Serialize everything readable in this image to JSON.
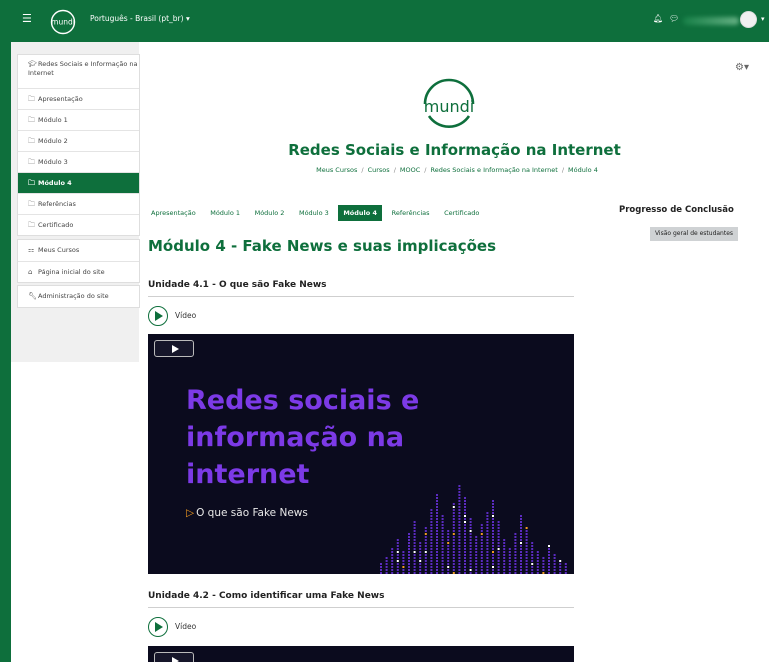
{
  "navbar": {
    "language_selector": "Português - Brasil (pt_br) ▾",
    "brand_color": "#0e6f3c"
  },
  "logo": {
    "text": "mundi"
  },
  "sidebar": {
    "course_group": [
      {
        "label": "Redes Sociais e Informação na Internet",
        "icon": "graduation-cap-icon"
      },
      {
        "label": "Apresentação",
        "icon": "folder-icon"
      },
      {
        "label": "Módulo 1",
        "icon": "folder-icon"
      },
      {
        "label": "Módulo 2",
        "icon": "folder-icon"
      },
      {
        "label": "Módulo 3",
        "icon": "folder-icon"
      },
      {
        "label": "Módulo 4",
        "icon": "folder-icon",
        "active": true
      },
      {
        "label": "Referências",
        "icon": "folder-icon"
      },
      {
        "label": "Certificado",
        "icon": "folder-icon"
      }
    ],
    "site_group": [
      {
        "label": "Meus Cursos",
        "icon": "cubes-icon"
      },
      {
        "label": "Página inicial do site",
        "icon": "home-icon"
      }
    ],
    "admin_group": [
      {
        "label": "Administração do site",
        "icon": "wrench-icon"
      }
    ]
  },
  "header": {
    "course_title": "Redes Sociais e Informação na Internet",
    "breadcrumb": [
      "Meus Cursos",
      "Cursos",
      "MOOC",
      "Redes Sociais e Informação na Internet",
      "Módulo 4"
    ]
  },
  "tabs": [
    {
      "label": "Apresentação"
    },
    {
      "label": "Módulo 1"
    },
    {
      "label": "Módulo 2"
    },
    {
      "label": "Módulo 3"
    },
    {
      "label": "Módulo 4",
      "active": true
    },
    {
      "label": "Referências"
    },
    {
      "label": "Certificado"
    }
  ],
  "progress": {
    "title": "Progresso de Conclusão",
    "overview_button": "Visão geral de estudantes"
  },
  "main": {
    "module_title": "Módulo 4 - Fake News e suas implicações",
    "units": [
      {
        "title": "Unidade 4.1 - O que são Fake News",
        "video_label": "Vídeo",
        "video": {
          "heading_line1": "Redes sociais e",
          "heading_line2": "informação na",
          "heading_line3": "internet",
          "subtitle": "O que são Fake News"
        }
      },
      {
        "title": "Unidade 4.2 - Como identificar uma Fake News",
        "video_label": "Vídeo"
      }
    ]
  }
}
